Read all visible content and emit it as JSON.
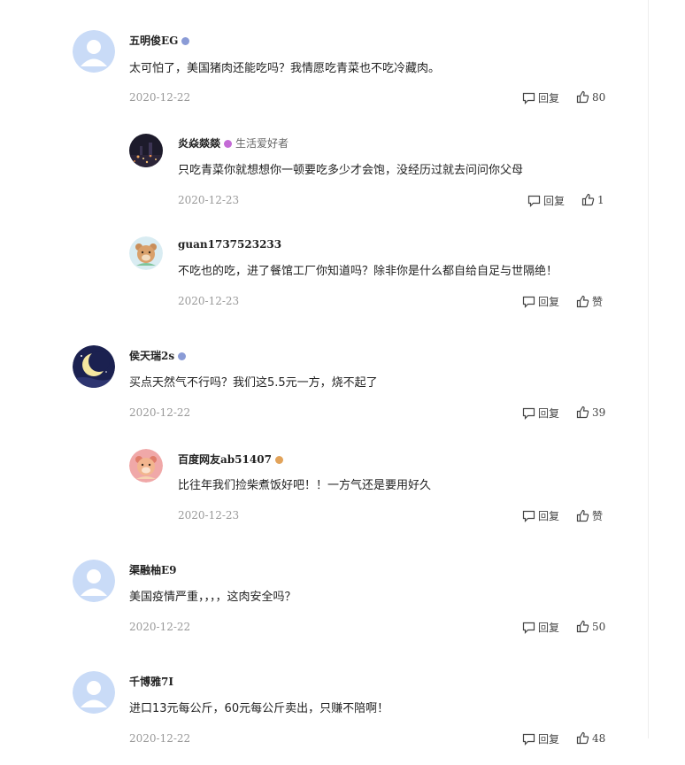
{
  "comments": [
    {
      "name": "五明俊EG",
      "badge_color": "#8a9bd6",
      "text": "太可怕了，美国猪肉还能吃吗？我情愿吃青菜也不吃冷藏肉。",
      "date": "2020-12-22",
      "reply_label": "回复",
      "like_label": "80",
      "avatar": "default-avatar"
    },
    {
      "name": "炎焱燚燚",
      "badge_color": "#c46bd6",
      "badge_text": "生活爱好者",
      "text": "只吃青菜你就想想你一顿要吃多少才会饱，没经历过就去问问你父母",
      "date": "2020-12-23",
      "reply_label": "回复",
      "like_label": "1",
      "avatar": "night-city-avatar"
    },
    {
      "name": "guan1737523233",
      "text": "不吃也的吃，进了餐馆工厂你知道吗？除非你是什么都自给自足与世隔绝！",
      "date": "2020-12-23",
      "reply_label": "回复",
      "like_label": "赞",
      "avatar": "bear-avatar"
    },
    {
      "name": "侯天瑞2s",
      "badge_color": "#8a9bd6",
      "text": "买点天然气不行吗？我们这5.5元一方，烧不起了",
      "date": "2020-12-22",
      "reply_label": "回复",
      "like_label": "39",
      "avatar": "moon-avatar"
    },
    {
      "name": "百度网友ab51407",
      "badge_color": "#e2a35a",
      "text": "比往年我们捡柴煮饭好吧！！一方气还是要用好久",
      "date": "2020-12-23",
      "reply_label": "回复",
      "like_label": "赞",
      "avatar": "bear-pink-avatar"
    },
    {
      "name": "渠融柚E9",
      "text": "美国疫情严重，，，，这肉安全吗？",
      "date": "2020-12-22",
      "reply_label": "回复",
      "like_label": "50",
      "avatar": "default-avatar"
    },
    {
      "name": "千博雅7I",
      "text": "进口13元每公斤，60元每公斤卖出，只赚不陪啊！",
      "date": "2020-12-22",
      "reply_label": "回复",
      "like_label": "48",
      "avatar": "default-avatar"
    }
  ]
}
